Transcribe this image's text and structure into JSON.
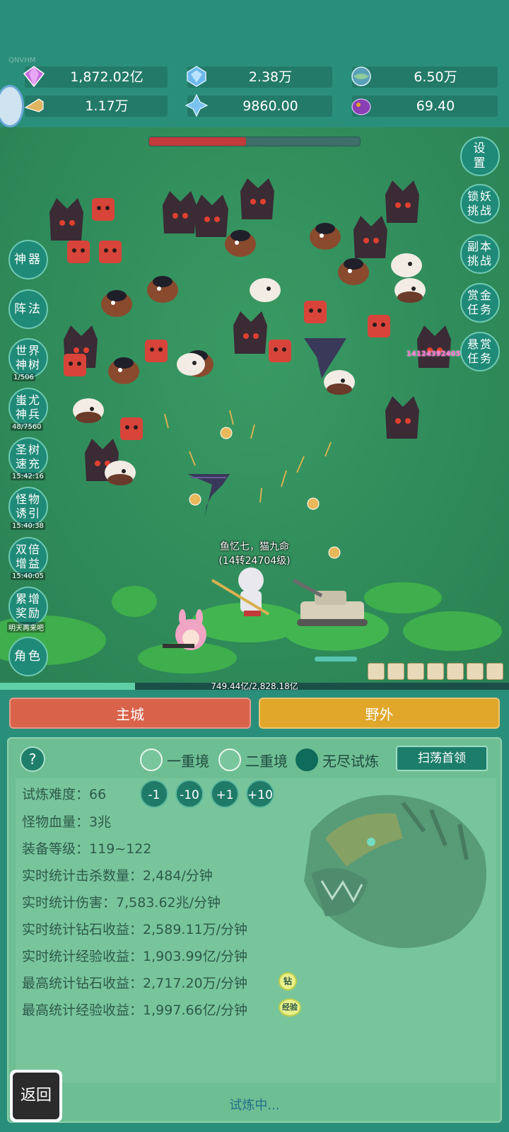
{
  "corner_tag": "QNVHM",
  "resources": {
    "row1": [
      {
        "icon": "purple-gem-icon",
        "value": "1,872.02亿"
      },
      {
        "icon": "blue-crystal-icon",
        "value": "2.38万"
      },
      {
        "icon": "globe-stone-icon",
        "value": "6.50万"
      }
    ],
    "row2": [
      {
        "icon": "horn-scroll-icon",
        "value": "1.17万"
      },
      {
        "icon": "ice-shard-icon",
        "value": "9860.00"
      },
      {
        "icon": "purple-orb-icon",
        "value": "69.40"
      }
    ]
  },
  "boss_hp_fraction": 0.46,
  "right_menu": {
    "settings": "设置",
    "lock_demon": "锁妖挑战",
    "dungeon": "副本挑战",
    "gold_task": "赏金任务",
    "bounty": "悬赏任务"
  },
  "left_menu": {
    "artifact": "神器",
    "formation": "阵法",
    "world_tree": "世界神树",
    "world_tree_sub": "1/506",
    "chiyou": "蚩尤神兵",
    "chiyou_sub": "48/7560",
    "holy_tree": "圣树速充",
    "holy_tree_sub": "15:42:16",
    "lure": "怪物诱引",
    "lure_sub": "15:40:38",
    "double": "双倍增益",
    "double_sub": "15:40:05",
    "reward": "累增奖励",
    "reward_sub": "明天再来吧",
    "role": "角色"
  },
  "battle": {
    "player_name": "鱼忆七，猫九命",
    "player_level": "(14转24704级)",
    "damage_popup": "141243924051",
    "exp_text": "749.44亿/2,828.18亿",
    "exp_fraction": 0.265
  },
  "tabs": {
    "main_city": "主城",
    "wild": "野外"
  },
  "panel": {
    "help": "?",
    "modes": [
      {
        "label": "一重境",
        "selected": false
      },
      {
        "label": "二重境",
        "selected": false
      },
      {
        "label": "无尽试炼",
        "selected": true
      }
    ],
    "sweep_button": "扫荡首领",
    "adjust": [
      "-1",
      "-10",
      "+1",
      "+10"
    ],
    "stats": [
      {
        "key": "试炼难度：",
        "value": "66"
      },
      {
        "key": "怪物血量：",
        "value": "3兆"
      },
      {
        "key": "装备等级：",
        "value": "119~122"
      },
      {
        "key": "实时统计击杀数量：",
        "value": "2,484/分钟"
      },
      {
        "key": "实时统计伤害：",
        "value": "7,583.62兆/分钟"
      },
      {
        "key": "实时统计钻石收益：",
        "value": "2,589.11万/分钟"
      },
      {
        "key": "实时统计经验收益：",
        "value": "1,903.99亿/分钟"
      },
      {
        "key": "最高统计钻石收益：",
        "value": "2,717.20万/分钟"
      },
      {
        "key": "最高统计经验收益：",
        "value": "1,997.66亿/分钟"
      }
    ],
    "diamond_badge": "钻",
    "exp_badge": "经验",
    "status": "试炼中..."
  },
  "back_button": "返回",
  "colors": {
    "bg": "#2a8f7a",
    "main_tab": "#d9624b",
    "wild_tab": "#e0a72a",
    "panel": "#6ebe94",
    "boss_hp": "#c23a3a"
  }
}
